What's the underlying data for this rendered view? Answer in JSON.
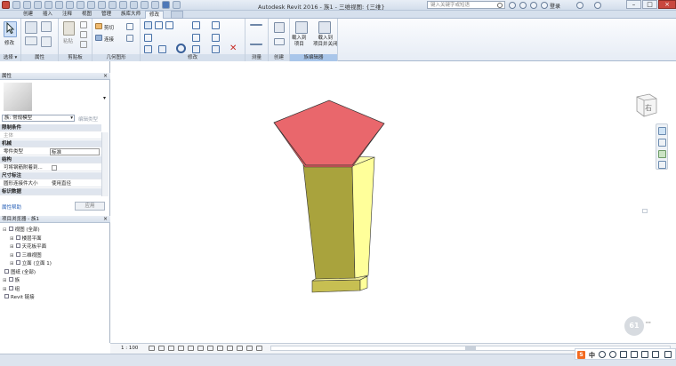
{
  "titlebar": {
    "app_title": "Autodesk Revit 2016 -  族1 - 三维视图: {三维}",
    "search_placeholder": "键入关键字或短语",
    "login_label": "登录"
  },
  "tabs": [
    "创建",
    "插入",
    "注释",
    "视图",
    "管理",
    "族库大师",
    "修改"
  ],
  "active_tab": "修改",
  "ribbon": {
    "panels": [
      {
        "label": "选择",
        "dropdown": true
      },
      {
        "label": "属性"
      },
      {
        "label": "剪贴板"
      },
      {
        "label": "几何图形"
      },
      {
        "label": "修改"
      },
      {
        "label": "测量"
      },
      {
        "label": "创建"
      },
      {
        "label": "族编辑器"
      }
    ],
    "modify_button": "修改",
    "paste_label": "粘贴",
    "cut_label": "剪切",
    "join_label": "连接",
    "load_into_project": "载入到\n项目",
    "load_into_project_close": "载入到\n项目并关闭"
  },
  "properties": {
    "header": "属性",
    "type_selector": "族: 常规模型",
    "edit_type": "编辑类型",
    "rows": [
      {
        "name": "限制条件",
        "category": true
      },
      {
        "name": "主体",
        "value": ""
      },
      {
        "name": "机械",
        "category": true
      },
      {
        "name": "零件类型",
        "value": "标准"
      },
      {
        "name": "结构",
        "category": true
      },
      {
        "name": "可将钢筋附着到...",
        "value": ""
      },
      {
        "name": "尺寸标注",
        "category": true
      },
      {
        "name": "圆形连接件大小",
        "value": "使用直径"
      },
      {
        "name": "标识数据",
        "category": true
      }
    ],
    "help_link": "属性帮助",
    "apply_button": "应用"
  },
  "browser": {
    "header": "项目浏览器 - 族1",
    "items": [
      {
        "label": "视图 (全部)",
        "level": 0,
        "expander": "-"
      },
      {
        "label": "楼层平面",
        "level": 1,
        "expander": "+"
      },
      {
        "label": "天花板平面",
        "level": 1,
        "expander": "+"
      },
      {
        "label": "三维视图",
        "level": 1,
        "expander": "+"
      },
      {
        "label": "立面 (立面 1)",
        "level": 1,
        "expander": "+"
      },
      {
        "label": "图纸 (全部)",
        "level": 0,
        "expander": ""
      },
      {
        "label": "族",
        "level": 0,
        "expander": "+"
      },
      {
        "label": "组",
        "level": 0,
        "expander": "+"
      },
      {
        "label": "Revit 链接",
        "level": 0,
        "expander": ""
      }
    ]
  },
  "viewcube": {
    "face_label": "右"
  },
  "viewbar": {
    "scale": "1 : 100"
  },
  "colors": {
    "cap_top": "#e9676c",
    "cap_side": "#e35a5e",
    "column_front": "#a9a33d",
    "column_side": "#ffff9a",
    "column_top": "#fcfcaa",
    "base": "#c7bf52",
    "ribbon_bg": "#e6ecf5",
    "active_panel": "#a9c6ea"
  },
  "nav_badge": {
    "value": "61"
  },
  "ime": {
    "label": "中"
  }
}
